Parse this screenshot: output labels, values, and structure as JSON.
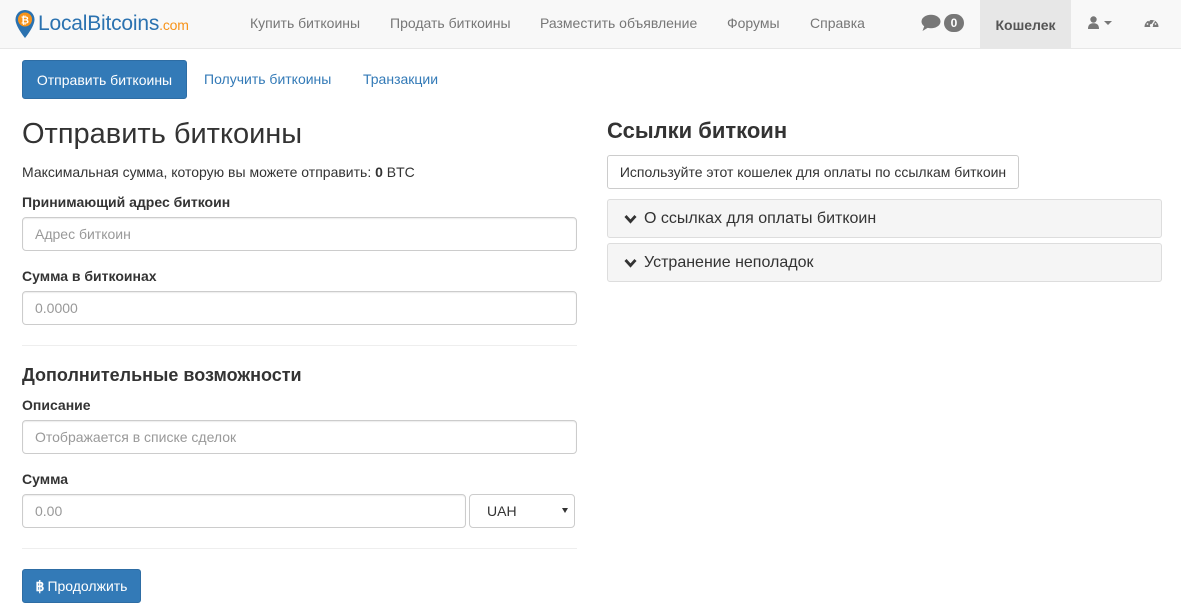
{
  "navbar": {
    "brand": {
      "name": "LocalBitcoins",
      "domain": ".com"
    },
    "links": [
      "Купить биткоины",
      "Продать биткоины",
      "Разместить объявление",
      "Форумы",
      "Справка"
    ],
    "messages_count": "0",
    "wallet": "Кошелек",
    "icons": {
      "chat": "comment-icon",
      "user": "user-icon",
      "dashboard": "dashboard-icon"
    }
  },
  "tabs": {
    "active": "Отправить биткоины",
    "others": [
      "Получить биткоины",
      "Транзакции"
    ]
  },
  "send": {
    "title": "Отправить биткоины",
    "max_prefix": "Максимальная сумма, которую вы можете отправить: ",
    "max_value": "0",
    "max_unit": " BTC",
    "address_label": "Принимающий адрес биткоин",
    "address_placeholder": "Адрес биткоин",
    "amount_label": "Сумма в биткоинах",
    "amount_placeholder": "0.0000",
    "extra_title": "Дополнительные возможности",
    "description_label": "Описание",
    "description_placeholder": "Отображается в списке сделок",
    "fiat_label": "Сумма",
    "fiat_placeholder": "0.00",
    "currency": "UAH",
    "continue_symbol": "฿",
    "continue_label": "Продолжить"
  },
  "links_panel": {
    "title": "Ссылки биткоин",
    "use_wallet_button": "Используйте этот кошелек для оплаты по ссылкам биткоин",
    "sections": [
      "О ссылках для оплаты биткоин",
      "Устранение неполадок"
    ]
  },
  "colors": {
    "primary": "#337ab7",
    "brand_orange": "#f7931a",
    "navbar_bg": "#f8f8f8",
    "panel_bg": "#f5f5f5"
  }
}
